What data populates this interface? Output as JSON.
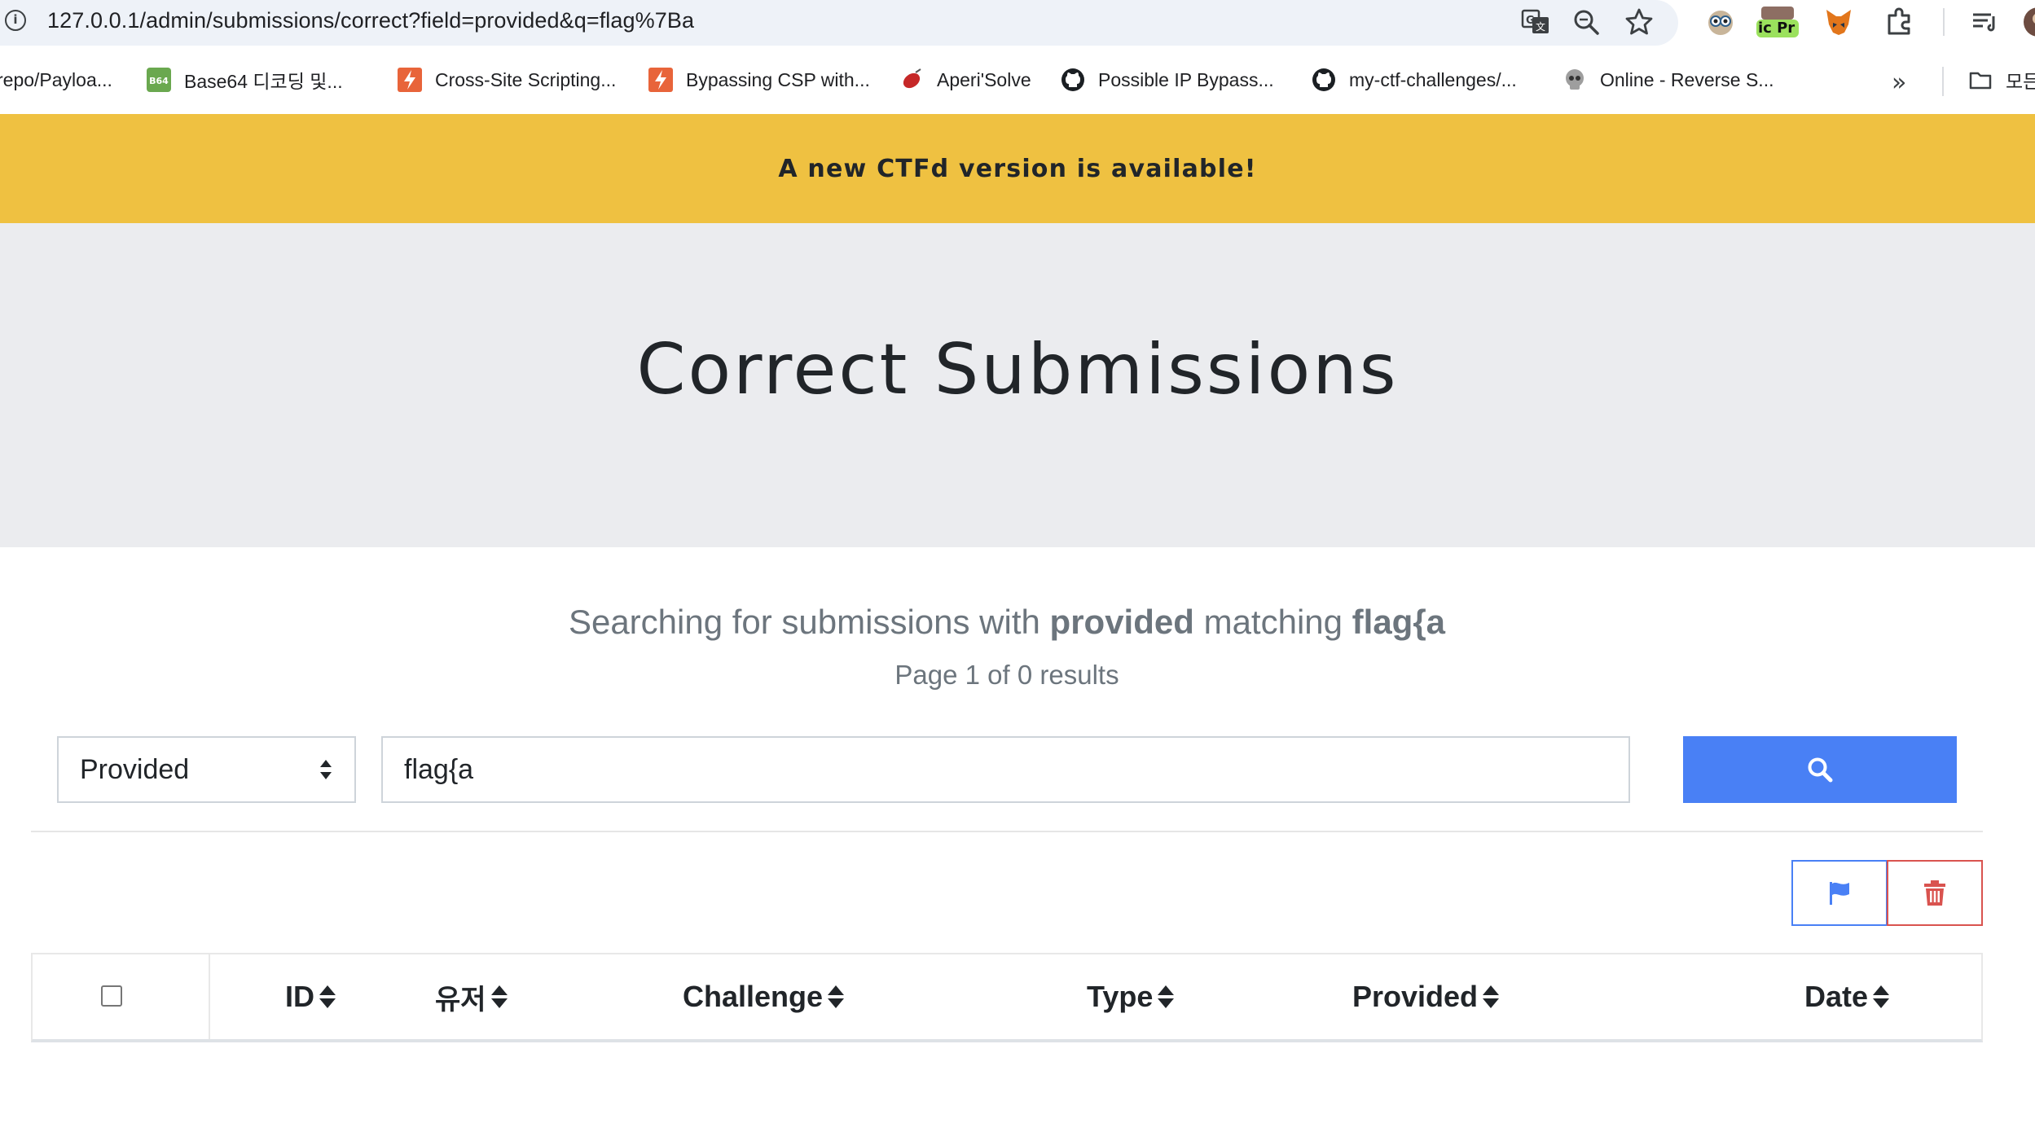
{
  "browser": {
    "url": "127.0.0.1/admin/submissions/correct?field=provided&q=flag%7Ba",
    "extension_badge": "ic Pr",
    "bookmarks": [
      {
        "label": "repo/Payloa...",
        "icon": "bookmark-icon"
      },
      {
        "label": "Base64 디코딩 및...",
        "icon": "b64-icon"
      },
      {
        "label": "Cross-Site Scripting...",
        "icon": "portswigger-icon"
      },
      {
        "label": "Bypassing CSP with...",
        "icon": "portswigger-icon"
      },
      {
        "label": "Aperi'Solve",
        "icon": "aperisolve-icon"
      },
      {
        "label": "Possible IP Bypass...",
        "icon": "github-icon"
      },
      {
        "label": "my-ctf-challenges/...",
        "icon": "github-icon"
      },
      {
        "label": "Online - Reverse S...",
        "icon": "skull-icon"
      },
      {
        "label": "모든",
        "icon": "folder-icon"
      }
    ]
  },
  "banner": {
    "text": "A new CTFd version is available!",
    "color": "#efc141"
  },
  "page": {
    "title": "Correct Submissions"
  },
  "search_summary": {
    "prefix": "Searching for submissions with",
    "field": "provided",
    "middle": "matching",
    "query": "flag{a",
    "page_info": "Page 1 of 0 results"
  },
  "search_form": {
    "field_selected": "Provided",
    "query_value": "flag{a",
    "button_color": "#4980f5"
  },
  "actions": {
    "flag_icon": "flag-icon",
    "delete_icon": "trash-icon"
  },
  "table": {
    "columns": [
      "ID",
      "유저",
      "Challenge",
      "Type",
      "Provided",
      "Date"
    ],
    "rows": []
  }
}
